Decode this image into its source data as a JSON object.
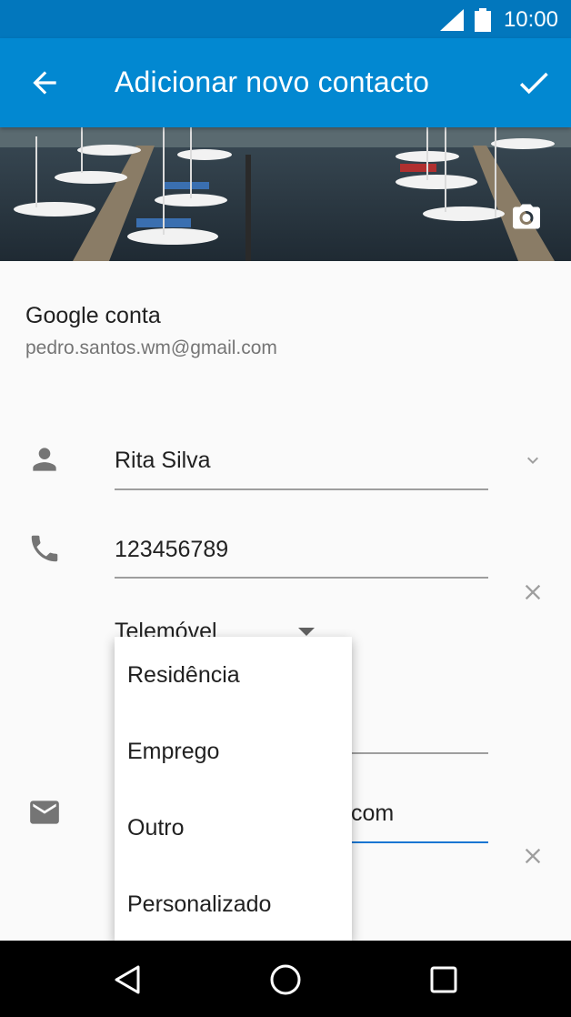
{
  "status_bar": {
    "time": "10:00"
  },
  "app_bar": {
    "title": "Adicionar novo contacto"
  },
  "account": {
    "title": "Google conta",
    "email": "pedro.santos.wm@gmail.com"
  },
  "fields": {
    "name": {
      "value": "Rita Silva"
    },
    "phone": {
      "value": "123456789",
      "type_label": "Telemóvel"
    },
    "email": {
      "value_visible": "com"
    }
  },
  "type_menu": {
    "items": [
      "Residência",
      "Emprego",
      "Outro",
      "Personalizado"
    ]
  },
  "colors": {
    "status_bar": "#0277bd",
    "app_bar": "#0288d1",
    "accent": "#1976d2"
  },
  "icons": [
    "back-arrow-icon",
    "checkmark-icon",
    "camera-icon",
    "person-icon",
    "phone-icon",
    "email-icon",
    "clear-icon",
    "chevron-down-icon",
    "nav-back-icon",
    "nav-home-icon",
    "nav-recents-icon",
    "signal-icon",
    "battery-icon"
  ]
}
